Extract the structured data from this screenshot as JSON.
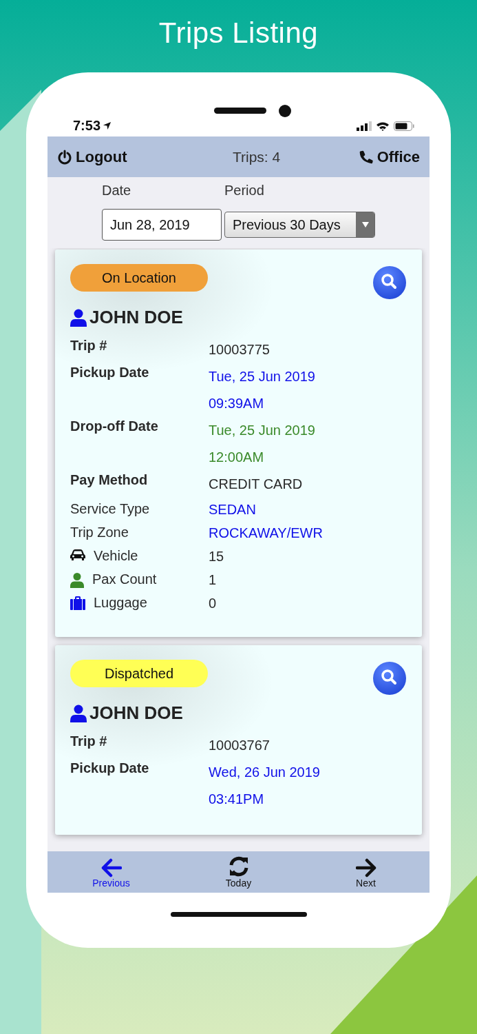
{
  "app_title": "Trips Listing",
  "status_bar": {
    "time": "7:53"
  },
  "header": {
    "logout": "Logout",
    "title": "Trips: 4",
    "office": "Office"
  },
  "filters": {
    "date_label": "Date",
    "period_label": "Period",
    "date_value": "Jun 28, 2019",
    "period_value": "Previous 30 Days"
  },
  "trips": [
    {
      "status": "On Location",
      "color": "#f0a03a",
      "passenger": "JOHN DOE",
      "fields": [
        {
          "kind": "bold",
          "label": "Trip #",
          "color": "#2a2a2a",
          "values": [
            "10003775"
          ]
        },
        {
          "kind": "bold",
          "label": "Pickup Date",
          "color": "#1010e8",
          "values": [
            "Tue, 25 Jun 2019",
            "09:39AM"
          ]
        },
        {
          "kind": "bold",
          "label": "Drop-off Date",
          "color": "#3a8a2a",
          "values": [
            "Tue, 25 Jun 2019",
            "12:00AM"
          ]
        },
        {
          "kind": "bold",
          "label": "Pay Method",
          "color": "#2a2a2a",
          "values": [
            "CREDIT CARD"
          ]
        },
        {
          "kind": "plain",
          "label": "Service Type",
          "color": "#1010e8",
          "values": [
            "SEDAN"
          ]
        },
        {
          "kind": "plain",
          "label": "Trip Zone",
          "color": "#1010e8",
          "values": [
            "ROCKAWAY/EWR"
          ]
        },
        {
          "kind": "car",
          "label": "Vehicle",
          "color": "#2a2a2a",
          "values": [
            "15"
          ]
        },
        {
          "kind": "person",
          "label": "Pax Count",
          "color": "#2a2a2a",
          "values": [
            "1"
          ]
        },
        {
          "kind": "suitcase",
          "label": "Luggage",
          "color": "#2a2a2a",
          "values": [
            "0"
          ]
        }
      ]
    },
    {
      "status": "Dispatched",
      "color": "#ffff55",
      "passenger": "JOHN DOE",
      "fields": [
        {
          "kind": "bold",
          "label": "Trip #",
          "color": "#2a2a2a",
          "values": [
            "10003767"
          ]
        },
        {
          "kind": "bold",
          "label": "Pickup Date",
          "color": "#1010e8",
          "values": [
            "Wed, 26 Jun 2019",
            "03:41PM"
          ]
        }
      ]
    }
  ],
  "nav": [
    {
      "label": "Previous",
      "selected": true
    },
    {
      "label": "Today",
      "selected": false
    },
    {
      "label": "Next",
      "selected": false
    }
  ]
}
